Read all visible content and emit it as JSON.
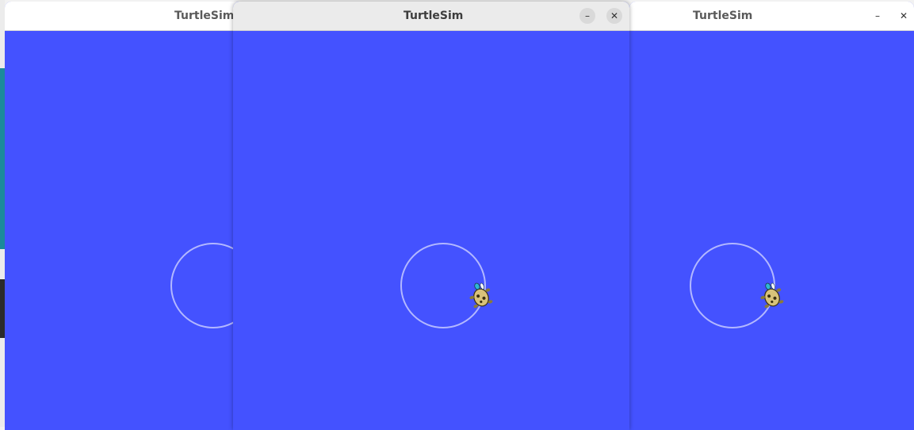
{
  "windows": {
    "left": {
      "title": "TurtleSim"
    },
    "middle": {
      "title": "TurtleSim",
      "minimize_glyph": "–",
      "close_glyph": "✕"
    },
    "right": {
      "title": "TurtleSim",
      "minimize_glyph": "–",
      "close_glyph": "✕"
    }
  },
  "colors": {
    "background": "#4452ff",
    "pen": "#b3b8ff",
    "turtle_shell": "#d8c27a"
  },
  "icons": {
    "minimize": "minimize-icon",
    "close": "close-icon",
    "turtle": "turtle-icon"
  }
}
